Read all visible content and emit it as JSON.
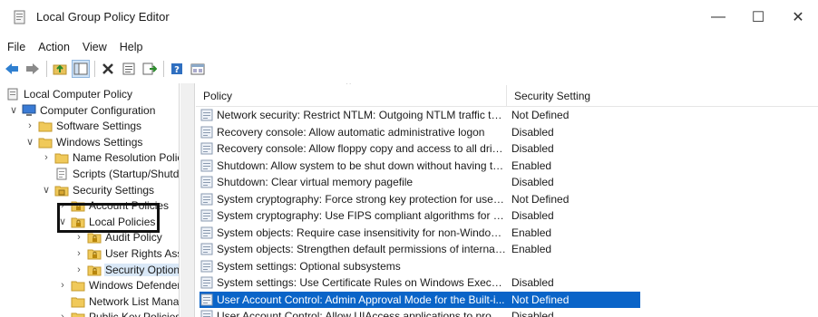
{
  "window": {
    "title": "Local Group Policy Editor",
    "controls": {
      "minimize": "—",
      "maximize": "☐",
      "close": "✕"
    }
  },
  "menu": [
    "File",
    "Action",
    "View",
    "Help"
  ],
  "toolbar": {
    "icons": [
      "back-arrow-icon",
      "forward-arrow-icon",
      "up-folder-icon",
      "show-hide-tree-icon",
      "delete-icon",
      "properties-icon",
      "export-list-icon",
      "help-icon",
      "extended-view-icon"
    ]
  },
  "tree": [
    {
      "label": "Local Computer Policy",
      "level": 0,
      "expander": "",
      "icon": "computer-policy-icon"
    },
    {
      "label": "Computer Configuration",
      "level": 1,
      "expander": "∨",
      "icon": "computer-icon"
    },
    {
      "label": "Software Settings",
      "level": 2,
      "expander": "›",
      "icon": "folder-icon"
    },
    {
      "label": "Windows Settings",
      "level": 2,
      "expander": "∨",
      "icon": "folder-icon"
    },
    {
      "label": "Name Resolution Polic",
      "level": 3,
      "expander": "›",
      "icon": "folder-icon"
    },
    {
      "label": "Scripts (Startup/Shutdc",
      "level": 3,
      "expander": "",
      "icon": "script-icon"
    },
    {
      "label": "Security Settings",
      "level": 3,
      "expander": "∨",
      "icon": "security-icon"
    },
    {
      "label": "Account Policies",
      "level": 4,
      "expander": "›",
      "icon": "lock-folder-icon"
    },
    {
      "label": "Local Policies",
      "level": 4,
      "expander": "∨",
      "icon": "lock-folder-icon"
    },
    {
      "label": "Audit Policy",
      "level": 5,
      "expander": "›",
      "icon": "lock-folder-icon"
    },
    {
      "label": "User Rights Ass",
      "level": 5,
      "expander": "›",
      "icon": "lock-folder-icon"
    },
    {
      "label": "Security Option",
      "level": 5,
      "expander": "›",
      "icon": "lock-folder-icon",
      "selected": true
    },
    {
      "label": "Windows Defender",
      "level": 4,
      "expander": "›",
      "icon": "folder-icon"
    },
    {
      "label": "Network List Mana",
      "level": 4,
      "expander": "",
      "icon": "folder-icon"
    },
    {
      "label": "Public Key Policies",
      "level": 4,
      "expander": "›",
      "icon": "folder-icon"
    }
  ],
  "list": {
    "columns": {
      "policy": "Policy",
      "setting": "Security Setting"
    },
    "rows": [
      {
        "policy": "Network security: Restrict NTLM: Outgoing NTLM traffic to r...",
        "setting": "Not Defined"
      },
      {
        "policy": "Recovery console: Allow automatic administrative logon",
        "setting": "Disabled"
      },
      {
        "policy": "Recovery console: Allow floppy copy and access to all drives...",
        "setting": "Disabled"
      },
      {
        "policy": "Shutdown: Allow system to be shut down without having to...",
        "setting": "Enabled"
      },
      {
        "policy": "Shutdown: Clear virtual memory pagefile",
        "setting": "Disabled"
      },
      {
        "policy": "System cryptography: Force strong key protection for user k...",
        "setting": "Not Defined"
      },
      {
        "policy": "System cryptography: Use FIPS compliant algorithms for en...",
        "setting": "Disabled"
      },
      {
        "policy": "System objects: Require case insensitivity for non-Windows ...",
        "setting": "Enabled"
      },
      {
        "policy": "System objects: Strengthen default permissions of internal s...",
        "setting": "Enabled"
      },
      {
        "policy": "System settings: Optional subsystems",
        "setting": ""
      },
      {
        "policy": "System settings: Use Certificate Rules on Windows Executab...",
        "setting": "Disabled"
      },
      {
        "policy": "User Account Control: Admin Approval Mode for the Built-i...",
        "setting": "Not Defined",
        "selected": true
      },
      {
        "policy": "User Account Control: Allow UIAccess applications to prom...",
        "setting": "Disabled"
      }
    ]
  },
  "colors": {
    "selection": "#0a64c8",
    "tree_selection": "#d9e8f7",
    "folder": "#e8c25a"
  }
}
